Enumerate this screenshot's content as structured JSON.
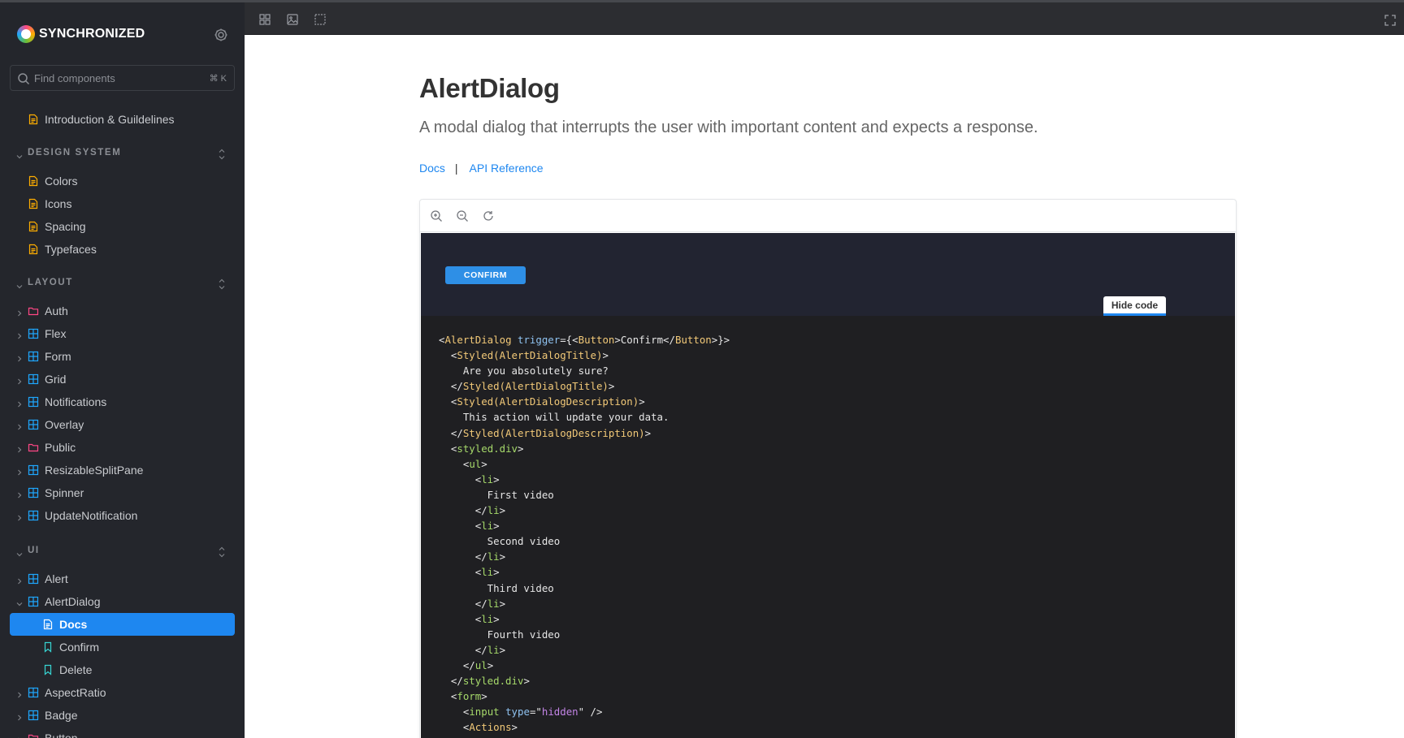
{
  "brand": {
    "name": "SYNCHRONIZED"
  },
  "search": {
    "placeholder": "Find components",
    "shortcut": "⌘ K"
  },
  "sidebar": {
    "intro": {
      "label": "Introduction & Guildelines",
      "icon": "document-icon"
    },
    "design_system": {
      "title": "DESIGN SYSTEM",
      "items": [
        {
          "label": "Colors",
          "icon": "document-icon"
        },
        {
          "label": "Icons",
          "icon": "document-icon"
        },
        {
          "label": "Spacing",
          "icon": "document-icon"
        },
        {
          "label": "Typefaces",
          "icon": "document-icon"
        }
      ]
    },
    "layout": {
      "title": "LAYOUT",
      "items": [
        {
          "label": "Auth",
          "icon": "folder-icon"
        },
        {
          "label": "Flex",
          "icon": "component-icon"
        },
        {
          "label": "Form",
          "icon": "component-icon"
        },
        {
          "label": "Grid",
          "icon": "component-icon"
        },
        {
          "label": "Notifications",
          "icon": "component-icon"
        },
        {
          "label": "Overlay",
          "icon": "component-icon"
        },
        {
          "label": "Public",
          "icon": "folder-icon"
        },
        {
          "label": "ResizableSplitPane",
          "icon": "component-icon"
        },
        {
          "label": "Spinner",
          "icon": "component-icon"
        },
        {
          "label": "UpdateNotification",
          "icon": "component-icon"
        }
      ]
    },
    "ui": {
      "title": "UI",
      "items": [
        {
          "label": "Alert",
          "icon": "component-icon"
        },
        {
          "label": "AlertDialog",
          "icon": "component-icon",
          "expanded": true
        },
        {
          "label": "Docs",
          "icon": "document-icon",
          "active": true
        },
        {
          "label": "Confirm",
          "icon": "bookmark-icon"
        },
        {
          "label": "Delete",
          "icon": "bookmark-icon"
        },
        {
          "label": "AspectRatio",
          "icon": "component-icon"
        },
        {
          "label": "Badge",
          "icon": "component-icon"
        },
        {
          "label": "Button",
          "icon": "folder-icon"
        }
      ]
    }
  },
  "page": {
    "title": "AlertDialog",
    "subtitle": "A modal dialog that interrupts the user with important content and expects a response.",
    "links": {
      "docs": "Docs",
      "separator": "|",
      "api": "API Reference"
    }
  },
  "preview": {
    "button_label": "CONFIRM",
    "hide_code_label": "Hide code"
  },
  "code_lines": [
    "<AlertDialog trigger={<Button>Confirm</Button>}>",
    "  <Styled(AlertDialogTitle)>",
    "    Are you absolutely sure?",
    "  </Styled(AlertDialogTitle)>",
    "  <Styled(AlertDialogDescription)>",
    "    This action will update your data.",
    "  </Styled(AlertDialogDescription)>",
    "  <styled.div>",
    "    <ul>",
    "      <li>",
    "        First video",
    "      </li>",
    "      <li>",
    "        Second video",
    "      </li>",
    "      <li>",
    "        Third video",
    "      </li>",
    "      <li>",
    "        Fourth video",
    "      </li>",
    "    </ul>",
    "  </styled.div>",
    "  <form>",
    "    <input type=\"hidden\" />",
    "    <Actions>"
  ],
  "colors": {
    "sidebar_bg": "#24262c",
    "accent": "#1e87f0",
    "folder": "#ff4785",
    "component": "#1ea7fd",
    "document": "#ffae00",
    "story": "#37d5d3"
  }
}
